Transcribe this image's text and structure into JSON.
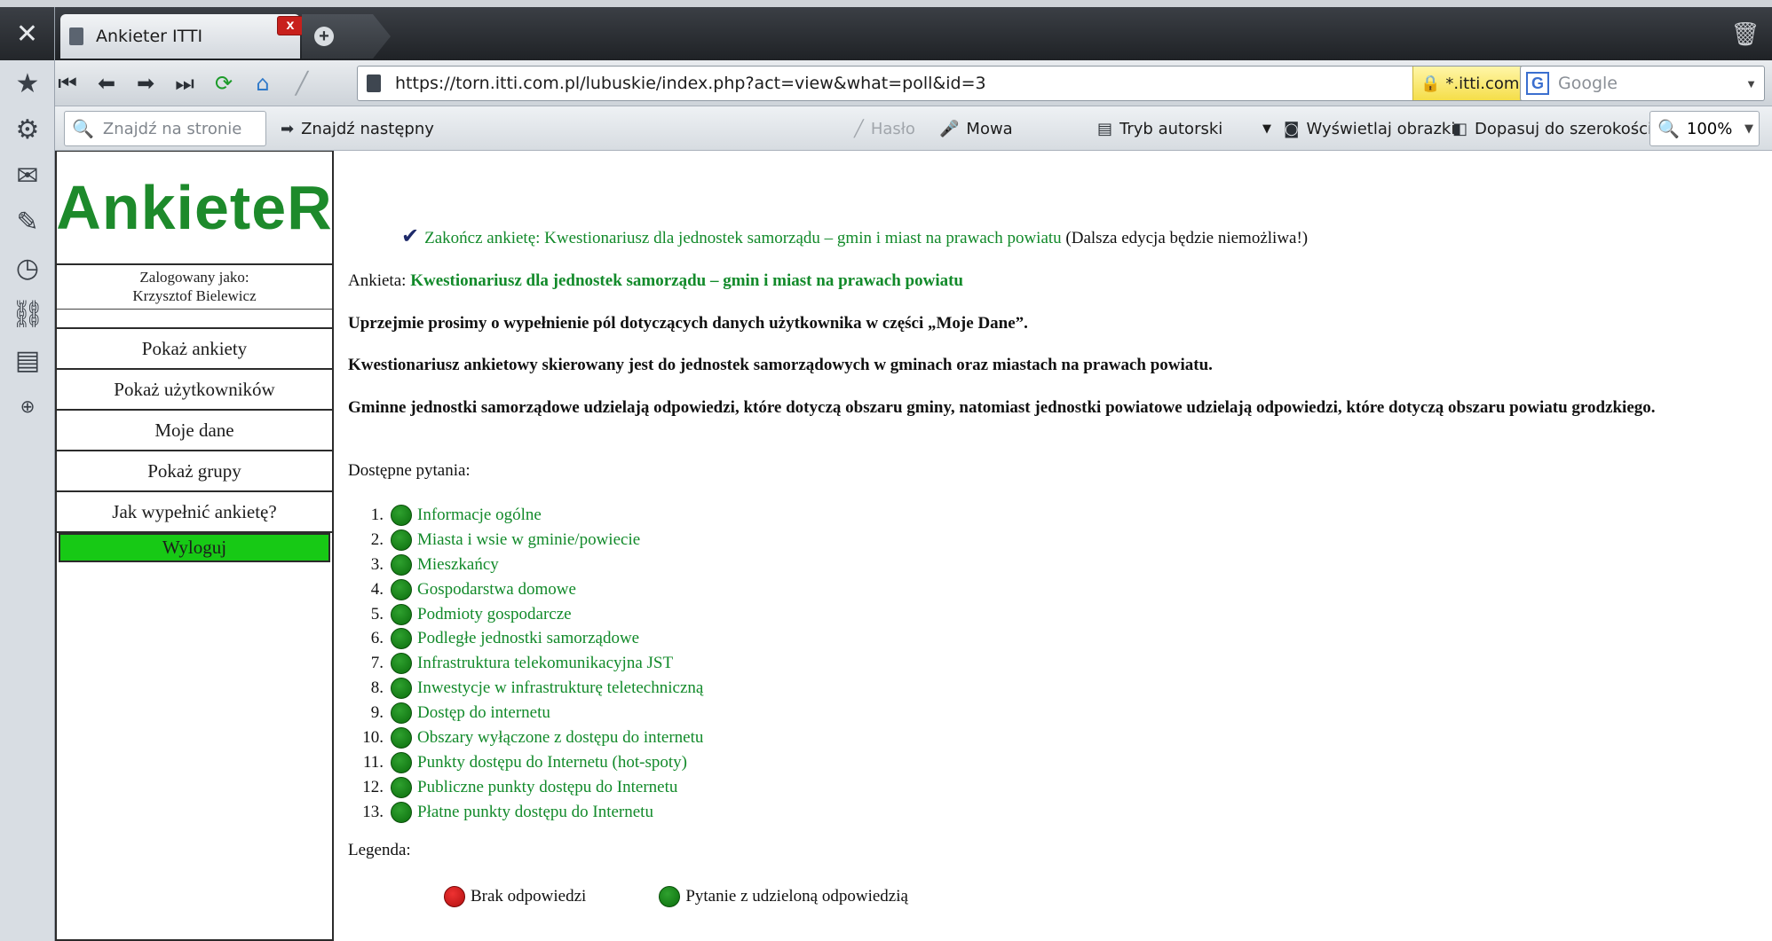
{
  "browser": {
    "tab_title": "Ankieter ITTI",
    "url": "https://torn.itti.com.pl/lubuskie/index.php?act=view&what=poll&id=3",
    "cert_domain": "*.itti.com.pl",
    "search_placeholder": "Google",
    "find_placeholder": "Znajdź na stronie",
    "find_next": "Znajdź następny",
    "password": "Hasło",
    "voice": "Mowa",
    "author_mode": "Tryb autorski",
    "show_images": "Wyświetlaj obrazki",
    "fit_width": "Dopasuj do szerokości",
    "zoom": "100%"
  },
  "sidebar": {
    "logo": "AnkieteR",
    "logged_label": "Zalogowany jako:",
    "logged_user": "Krzysztof Bielewicz",
    "menu": [
      {
        "label": "Pokaż ankiety"
      },
      {
        "label": "Pokaż użytkowników"
      },
      {
        "label": "Moje dane"
      },
      {
        "label": "Pokaż grupy"
      },
      {
        "label": "Jak wypełnić ankietę?"
      }
    ],
    "logout": "Wyloguj"
  },
  "main": {
    "finish_link": "Zakończ ankietę: Kwestionariusz dla jednostek samorządu – gmin i miast na prawach powiatu",
    "finish_note": "(Dalsza edycja będzie niemożliwa!)",
    "poll_label": "Ankieta:",
    "poll_title": "Kwestionariusz dla jednostek samorządu – gmin i miast na prawach powiatu",
    "para1": "Uprzejmie prosimy o wypełnienie pól dotyczących danych użytkownika w części „Moje Dane”.",
    "para2": "Kwestionariusz ankietowy skierowany jest do jednostek samorządowych w gminach oraz miastach na prawach powiatu.",
    "para3": "Gminne jednostki samorządowe udzielają odpowiedzi, które dotyczą obszaru gminy, natomiast jednostki powiatowe udzielają odpowiedzi, które dotyczą obszaru powiatu grodzkiego.",
    "available": "Dostępne pytania:",
    "questions": [
      {
        "num": "1.",
        "label": "Informacje ogólne"
      },
      {
        "num": "2.",
        "label": "Miasta i wsie w gminie/powiecie"
      },
      {
        "num": "3.",
        "label": "Mieszkańcy"
      },
      {
        "num": "4.",
        "label": "Gospodarstwa domowe"
      },
      {
        "num": "5.",
        "label": "Podmioty gospodarcze"
      },
      {
        "num": "6.",
        "label": "Podległe jednostki samorządowe"
      },
      {
        "num": "7.",
        "label": "Infrastruktura telekomunikacyjna JST"
      },
      {
        "num": "8.",
        "label": "Inwestycje w infrastrukturę teletechniczną"
      },
      {
        "num": "9.",
        "label": "Dostęp do internetu"
      },
      {
        "num": "10.",
        "label": "Obszary wyłączone z dostępu do internetu"
      },
      {
        "num": "11.",
        "label": "Punkty dostępu do Internetu (hot-spoty)"
      },
      {
        "num": "12.",
        "label": "Publiczne punkty dostępu do Internetu"
      },
      {
        "num": "13.",
        "label": "Płatne punkty dostępu do Internetu"
      }
    ],
    "legend_label": "Legenda:",
    "legend_no_answer": "Brak odpowiedzi",
    "legend_answered": "Pytanie z udzieloną odpowiedzią"
  },
  "colors": {
    "brand_green": "#1d8a2b",
    "link_green": "#128a2a",
    "logout_bg": "#17c915",
    "answered": "#0b6e0d",
    "unanswered": "#c81a1a"
  }
}
